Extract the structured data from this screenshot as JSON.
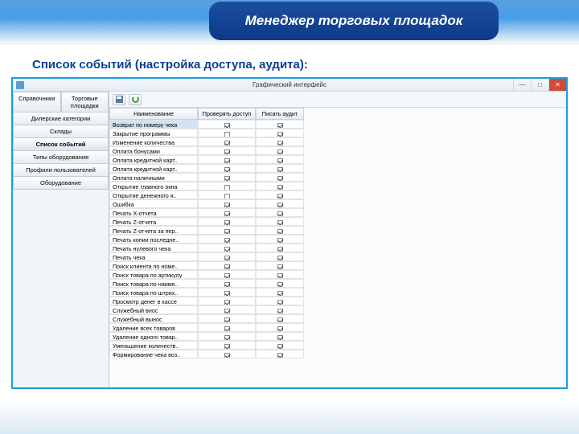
{
  "banner_title": "Менеджер торговых площадок",
  "subtitle": "Список событий (настройка доступа, аудита):",
  "window": {
    "title": "Графический интерфейс",
    "min": "—",
    "max": "□",
    "close": "✕"
  },
  "sidebar": {
    "tabs": [
      {
        "label": "Справочники"
      },
      {
        "label": "Торговые площадки"
      }
    ],
    "items": [
      {
        "label": "Дилерские категории"
      },
      {
        "label": "Склады"
      },
      {
        "label": "Список событий"
      },
      {
        "label": "Типы оборудования"
      },
      {
        "label": "Профили пользователей"
      },
      {
        "label": "Оборудование"
      }
    ],
    "active_index": 2
  },
  "toolbar": {
    "save_name": "save",
    "refresh_name": "refresh"
  },
  "grid": {
    "headers": [
      "Наименование",
      "Проверять доступ",
      "Писать аудит"
    ],
    "rows": [
      {
        "name": "Возврат по номеру чека",
        "access": true,
        "audit": true,
        "selected": true
      },
      {
        "name": "Закрытие программы",
        "access": false,
        "audit": true
      },
      {
        "name": "Изменение количества",
        "access": true,
        "audit": true
      },
      {
        "name": "Оплата бонусами",
        "access": true,
        "audit": true
      },
      {
        "name": "Оплата кредитной карт..",
        "access": true,
        "audit": true
      },
      {
        "name": "Оплата кредитной карт..",
        "access": true,
        "audit": true
      },
      {
        "name": "Оплата наличными",
        "access": true,
        "audit": true
      },
      {
        "name": "Открытие главного окна",
        "access": false,
        "audit": true
      },
      {
        "name": "Открытие денежного я..",
        "access": false,
        "audit": true
      },
      {
        "name": "Ошибка",
        "access": true,
        "audit": true
      },
      {
        "name": "Печать X-отчета",
        "access": true,
        "audit": true
      },
      {
        "name": "Печать Z-отчета",
        "access": true,
        "audit": true
      },
      {
        "name": "Печать Z-отчета за пер..",
        "access": true,
        "audit": true
      },
      {
        "name": "Печать копии последне..",
        "access": true,
        "audit": true
      },
      {
        "name": "Печать нулевого чека",
        "access": true,
        "audit": true
      },
      {
        "name": "Печать чека",
        "access": true,
        "audit": true
      },
      {
        "name": "Поиск клиента по номе..",
        "access": true,
        "audit": true
      },
      {
        "name": "Поиск товара по артикулу",
        "access": true,
        "audit": true
      },
      {
        "name": "Поиск товара по наиме..",
        "access": true,
        "audit": true
      },
      {
        "name": "Поиск товара по штрих..",
        "access": true,
        "audit": true
      },
      {
        "name": "Просмотр денег в кассе",
        "access": true,
        "audit": true
      },
      {
        "name": "Служебный внос",
        "access": true,
        "audit": true
      },
      {
        "name": "Служебный вынос",
        "access": true,
        "audit": true
      },
      {
        "name": "Удаление всех товаров",
        "access": true,
        "audit": true
      },
      {
        "name": "Удаление одного товар..",
        "access": true,
        "audit": true
      },
      {
        "name": "Уменьшение количеств..",
        "access": true,
        "audit": true
      },
      {
        "name": "Формирование чека воз..",
        "access": true,
        "audit": true
      }
    ]
  }
}
